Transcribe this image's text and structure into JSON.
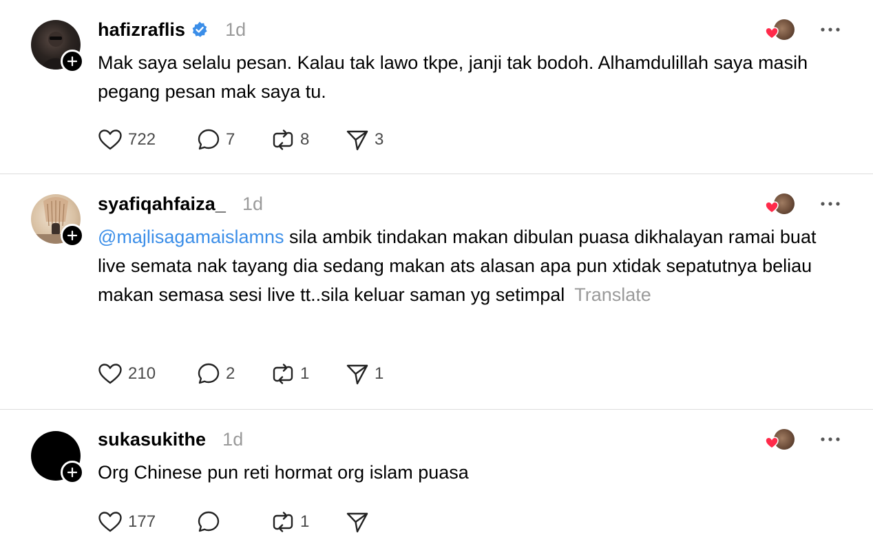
{
  "colors": {
    "mention": "#3b8ee8",
    "verified": "#3b8ee8",
    "heart": "#ff2a4a",
    "muted": "#9a9a9a"
  },
  "posts": [
    {
      "username": "hafizraflis",
      "verified": true,
      "time": "1d",
      "text": "Mak saya selalu pesan. Kalau tak lawo tkpe, janji tak bodoh. Alhamdulillah saya masih pegang pesan mak saya tu.",
      "mention": "",
      "translate": "",
      "likes": "722",
      "replies": "7",
      "reposts": "8",
      "shares": "3"
    },
    {
      "username": "syafiqahfaiza_",
      "verified": false,
      "time": "1d",
      "mention": "@majlisagamaislamns",
      "text": " sila ambik tindakan makan dibulan puasa dikhalayan ramai buat live semata nak tayang dia sedang makan ats alasan apa pun xtidak sepatutnya beliau makan semasa sesi live tt..sila keluar saman yg setimpal",
      "translate": "Translate",
      "likes": "210",
      "replies": "2",
      "reposts": "1",
      "shares": "1"
    },
    {
      "username": "sukasukithe",
      "verified": false,
      "time": "1d",
      "text": "Org Chinese pun reti hormat org islam puasa",
      "mention": "",
      "translate": "",
      "likes": "177",
      "replies": "",
      "reposts": "1",
      "shares": ""
    }
  ],
  "icons": {
    "follow": "plus-icon",
    "verified": "verified-badge-icon",
    "like": "heart-icon",
    "reply": "comment-bubble-icon",
    "repost": "repost-arrows-icon",
    "share": "send-paper-plane-icon",
    "more": "more-dots-icon"
  }
}
